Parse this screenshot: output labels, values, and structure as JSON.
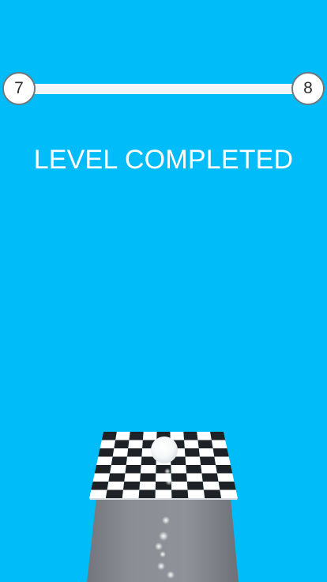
{
  "hud": {
    "current_level": "7",
    "next_level": "8",
    "progress_fraction": 1.0,
    "title": "LEVEL COMPLETED"
  },
  "colors": {
    "background": "#00bcf8",
    "bar": "#f3f6f8",
    "tile_dark": "#1e2126",
    "tile_light": "#ffffff",
    "pipe": "#85898f"
  },
  "scene": {
    "ball-icon": "white-sphere",
    "platform": "checkerboard-finish-pad",
    "track": "grey-funnel-pipe"
  }
}
